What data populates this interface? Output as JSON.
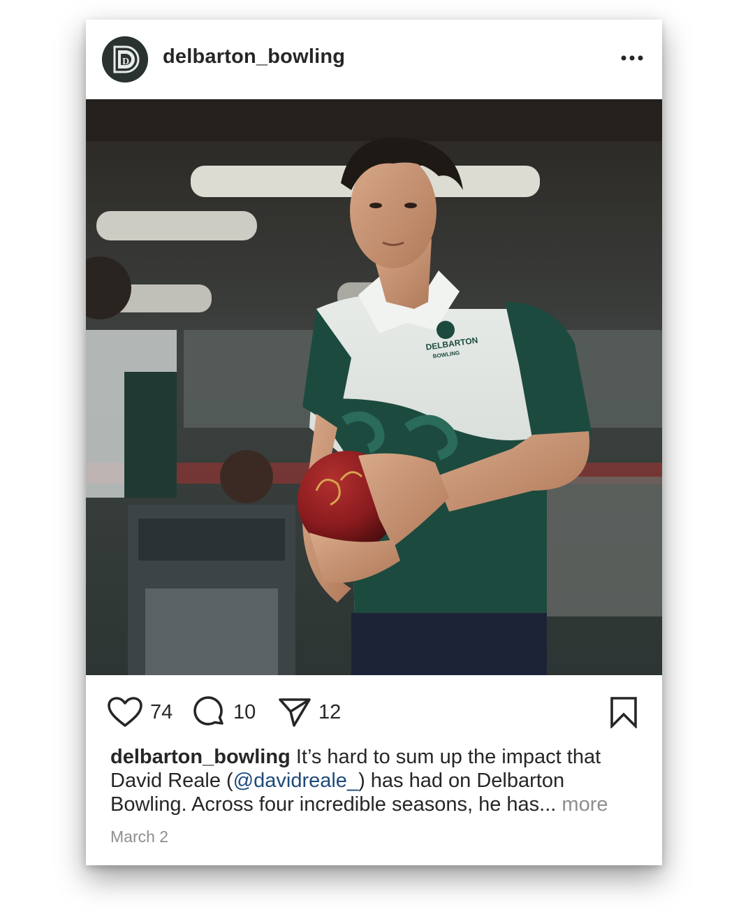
{
  "post": {
    "username": "delbarton_bowling",
    "more_icon": "more-horizontal-icon",
    "avatar": {
      "letter": "D",
      "bg_color": "#2b3330"
    },
    "photo": {
      "jersey_text": "DELBARTON",
      "jersey_subtext": "BOWLING",
      "jersey_accent": "#1d4a3e",
      "ball_color": "#8a1b1e"
    },
    "actions": {
      "likes": "74",
      "comments": "10",
      "shares": "12"
    },
    "caption": {
      "username": "delbarton_bowling",
      "text_part1": " It’s hard to sum up the impact that David Reale (",
      "mention": "@davidreale_",
      "text_part2": ") has had on Delbarton Bowling. Across four incredible seasons, he has... ",
      "more_label": "more"
    },
    "date": "March 2"
  }
}
